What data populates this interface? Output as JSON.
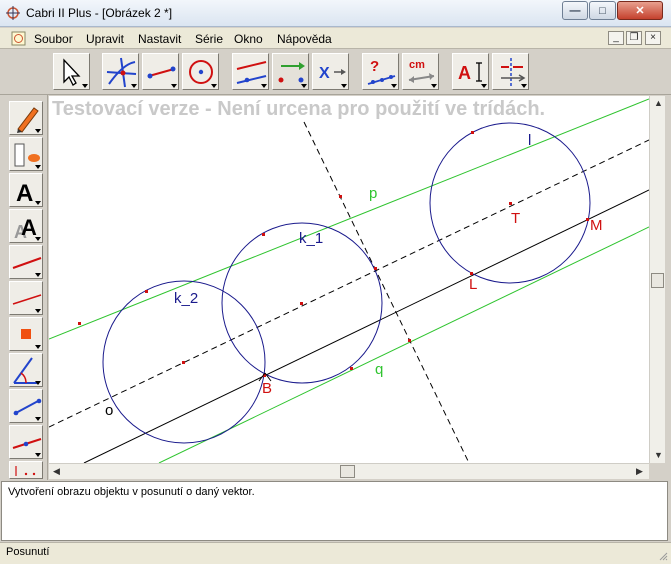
{
  "window": {
    "title": "Cabri II Plus - [Obrázek 2 *]",
    "minimize_icon": "minimize-icon",
    "maximize_icon": "maximize-icon",
    "close_icon": "close-icon"
  },
  "menubar": {
    "items": [
      "Soubor",
      "Upravit",
      "Nastavit",
      "Série",
      "Okno",
      "Nápověda"
    ]
  },
  "toolbar": {
    "tools": [
      {
        "icon": "pointer-icon"
      },
      {
        "icon": "intersection-points-icon"
      },
      {
        "icon": "segment-icon"
      },
      {
        "icon": "circle-icon"
      },
      {
        "icon": "parallel-line-icon"
      },
      {
        "icon": "vector-translation-icon"
      },
      {
        "icon": "measure-x-icon"
      },
      {
        "icon": "check-property-icon"
      },
      {
        "icon": "distance-length-icon"
      },
      {
        "icon": "label-text-icon"
      },
      {
        "icon": "mark-angle-icon"
      }
    ]
  },
  "canvas": {
    "watermark": "Testovací verze - Není urcena pro použití ve trídách.",
    "labels": {
      "p": "p",
      "q": "q",
      "o": "o",
      "l": "l",
      "k1": "k_1",
      "k2": "k_2",
      "T": "T",
      "M": "M",
      "L": "L",
      "B": "B"
    },
    "colors": {
      "circle": "#1a1a8c",
      "parallel": "#2fc42f",
      "point": "#d01010",
      "label_red": "#d01010",
      "label_blue": "#1a1a8c",
      "label_green": "#2fc42f"
    }
  },
  "help_text": "Vytvoření obrazu objektu v posunutí o daný vektor.",
  "status_text": "Posunutí"
}
